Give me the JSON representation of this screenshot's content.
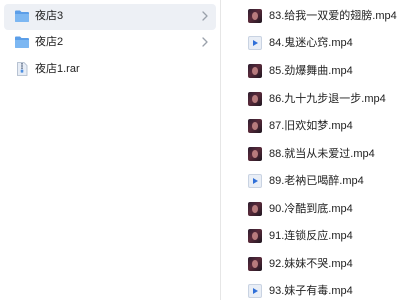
{
  "left_pane": {
    "items": [
      {
        "label": "夜店3",
        "icon": "folder-icon",
        "has_chevron": true,
        "selected": true
      },
      {
        "label": "夜店2",
        "icon": "folder-icon",
        "has_chevron": true,
        "selected": false
      },
      {
        "label": "夜店1.rar",
        "icon": "archive-file-icon",
        "has_chevron": false,
        "selected": false
      }
    ]
  },
  "right_pane": {
    "files": [
      {
        "label": "83.给我一双爱的翅膀.mp4",
        "thumb": "video-thumbnail"
      },
      {
        "label": "84.鬼迷心窍.mp4",
        "thumb": "video-file-icon"
      },
      {
        "label": "85.劲爆舞曲.mp4",
        "thumb": "video-thumbnail"
      },
      {
        "label": "86.九十九步退一步.mp4",
        "thumb": "video-thumbnail"
      },
      {
        "label": "87.旧欢如梦.mp4",
        "thumb": "video-thumbnail"
      },
      {
        "label": "88.就当从未爱过.mp4",
        "thumb": "video-thumbnail"
      },
      {
        "label": "89.老衲已喝醉.mp4",
        "thumb": "video-file-icon"
      },
      {
        "label": "90.冷酷到底.mp4",
        "thumb": "video-thumbnail"
      },
      {
        "label": "91.连锁反应.mp4",
        "thumb": "video-thumbnail"
      },
      {
        "label": "92.妹妹不哭.mp4",
        "thumb": "video-thumbnail"
      },
      {
        "label": "93.妹子有毒.mp4",
        "thumb": "video-file-icon"
      }
    ]
  },
  "colors": {
    "folder": "#6aa9ec",
    "selected_bg": "#edf0f5",
    "chevron": "#9aa1ab"
  }
}
